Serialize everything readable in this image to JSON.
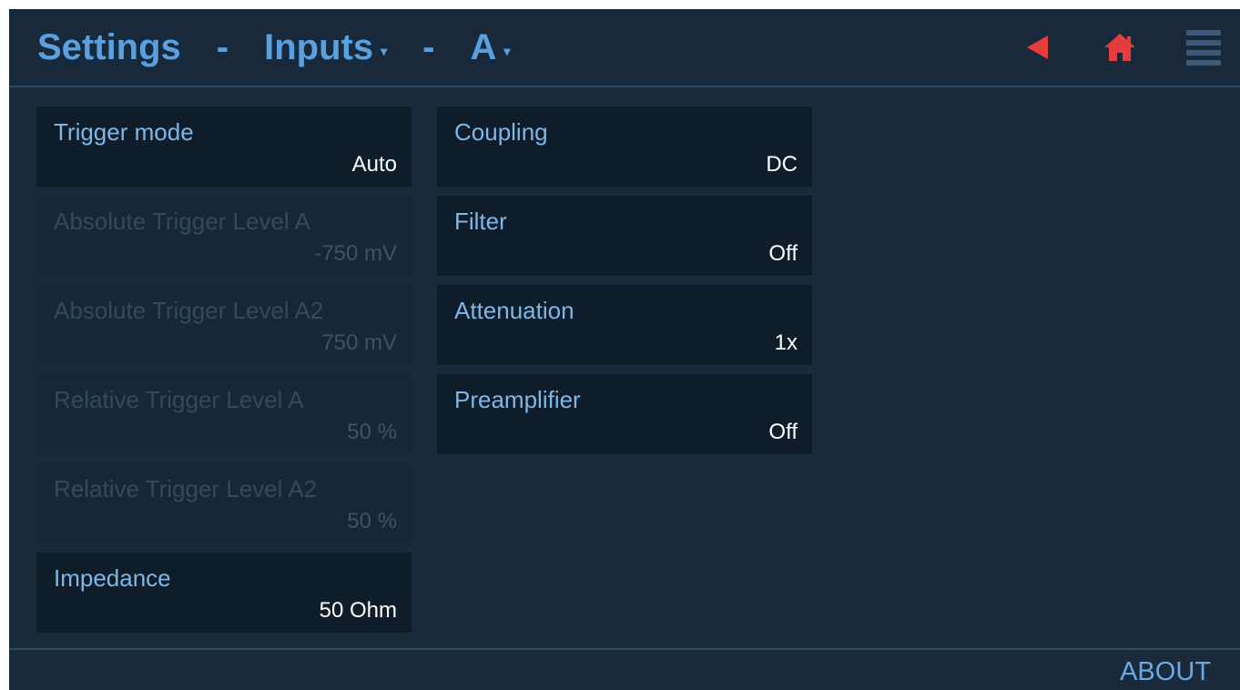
{
  "header": {
    "crumb1": "Settings",
    "sep1": "-",
    "crumb2": "Inputs",
    "sep2": "-",
    "crumb3": "A",
    "dropdown_caret": "▾",
    "icons": {
      "back": "back-arrow-icon",
      "home": "home-icon",
      "menu": "hamburger-menu-icon"
    },
    "accent_color": "#5a9fde",
    "icon_color": "#e63c3c"
  },
  "left_settings": [
    {
      "label": "Trigger mode",
      "value": "Auto",
      "enabled": true
    },
    {
      "label": "Absolute Trigger Level A",
      "value": "-750 mV",
      "enabled": false
    },
    {
      "label": "Absolute Trigger Level A2",
      "value": "750 mV",
      "enabled": false
    },
    {
      "label": "Relative Trigger Level A",
      "value": "50 %",
      "enabled": false
    },
    {
      "label": "Relative Trigger Level A2",
      "value": "50 %",
      "enabled": false
    },
    {
      "label": "Impedance",
      "value": "50 Ohm",
      "enabled": true
    }
  ],
  "right_settings": [
    {
      "label": "Coupling",
      "value": "DC",
      "enabled": true
    },
    {
      "label": "Filter",
      "value": "Off",
      "enabled": true
    },
    {
      "label": "Attenuation",
      "value": "1x",
      "enabled": true
    },
    {
      "label": "Preamplifier",
      "value": "Off",
      "enabled": true
    }
  ],
  "footer": {
    "about_label": "ABOUT"
  }
}
